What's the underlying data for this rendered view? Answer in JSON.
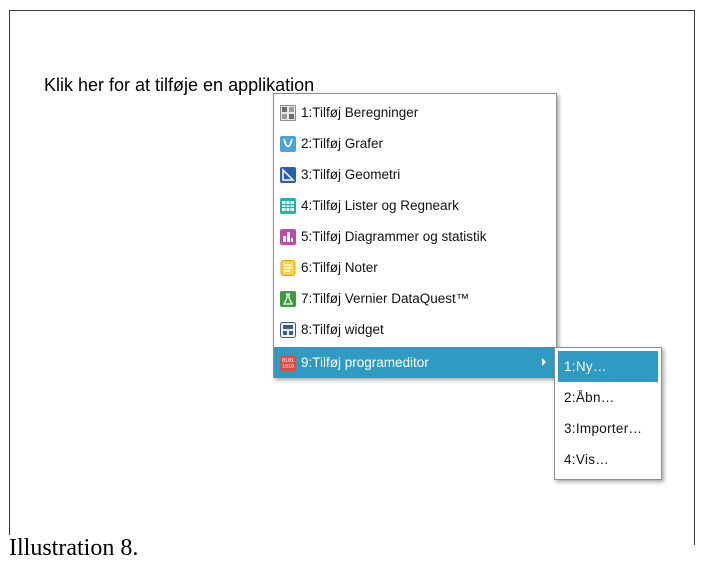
{
  "prompt": "Klik her for at tilføje en applikation",
  "caption": "Illustration 8.",
  "menu": {
    "items": [
      {
        "label": "1:Tilføj Beregninger",
        "icon": "calculator-icon"
      },
      {
        "label": "2:Tilføj Grafer",
        "icon": "graphs-icon"
      },
      {
        "label": "3:Tilføj Geometri",
        "icon": "geometry-icon"
      },
      {
        "label": "4:Tilføj Lister og Regneark",
        "icon": "spreadsheet-icon"
      },
      {
        "label": "5:Tilføj Diagrammer og statistik",
        "icon": "statistics-icon"
      },
      {
        "label": "6:Tilføj Noter",
        "icon": "notes-icon"
      },
      {
        "label": "7:Tilføj Vernier DataQuest™",
        "icon": "dataquest-icon"
      },
      {
        "label": "8:Tilføj widget",
        "icon": "widget-icon"
      },
      {
        "label": "9:Tilføj programeditor",
        "icon": "program-editor-icon"
      }
    ]
  },
  "submenu": {
    "items": [
      {
        "label": "1:Ny…"
      },
      {
        "label": "2:Åbn…"
      },
      {
        "label": "3:Importer…"
      },
      {
        "label": "4:Vis…"
      }
    ]
  },
  "colors": {
    "highlight": "#2f9bc3"
  }
}
